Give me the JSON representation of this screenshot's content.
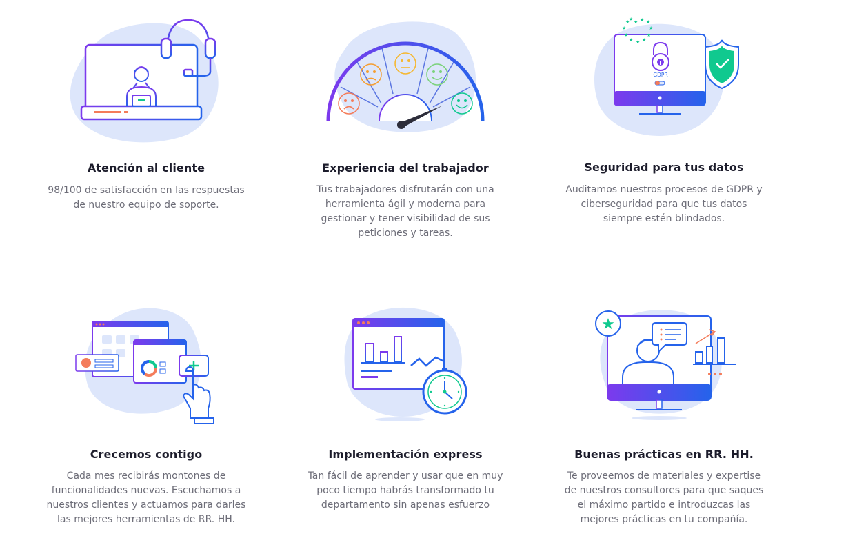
{
  "features": [
    {
      "title": "Atención al cliente",
      "desc": "98/100 de satisfacción en las respuestas de nuestro equipo de soporte."
    },
    {
      "title": "Experiencia del trabajador",
      "desc": "Tus trabajadores disfrutarán con una herramienta ágil y moderna para gestionar y tener visibilidad de sus peticiones y tareas."
    },
    {
      "title": "Seguridad para tus datos",
      "desc": "Auditamos nuestros procesos de GDPR y ciberseguridad para que tus datos siempre estén blindados.",
      "badge_label": "GDPR"
    },
    {
      "title": "Crecemos contigo",
      "desc": "Cada mes recibirás montones de funcionalidades nuevas. Escuchamos a nuestros clientes y actuamos para darles las mejores herramientas de RR. HH."
    },
    {
      "title": "Implementación express",
      "desc": "Tan fácil de aprender y usar que en muy poco tiempo habrás transformado tu departamento sin apenas esfuerzo"
    },
    {
      "title": "Buenas prácticas en RR. HH.",
      "desc": "Te proveemos de materiales y expertise de nuestros consultores para que saques el máximo partido e introduzcas las mejores prácticas en tu compañía."
    }
  ],
  "colors": {
    "blob": "#dde6fb",
    "blue": "#2563eb",
    "purple": "#7c3aed",
    "orange": "#f47c5a",
    "green": "#10c98f",
    "yellow": "#f5b833"
  }
}
